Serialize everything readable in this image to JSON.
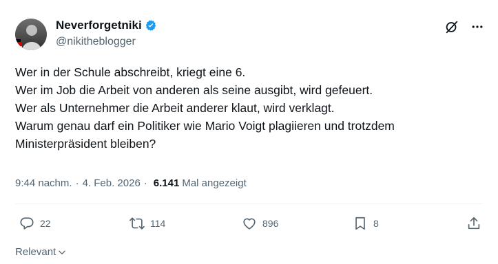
{
  "author": {
    "display_name": "Neverforgetniki",
    "handle": "@nikitheblogger",
    "verified": true,
    "verified_color": "#1d9bf0"
  },
  "top_icons": [
    "grok-icon",
    "more-icon"
  ],
  "tweet": {
    "lines": [
      "Wer in der Schule abschreibt, kriegt eine 6.",
      "Wer im Job die Arbeit von anderen als seine ausgibt, wird gefeuert.",
      "Wer als Unternehmer die Arbeit anderer klaut, wird verklagt.",
      "Warum genau darf ein Politiker wie Mario Voigt plagiieren und trotzdem",
      "Ministerpräsident bleiben?"
    ]
  },
  "meta": {
    "time": "9:44 nachm.",
    "separator": "·",
    "date": "4. Feb. 2026",
    "views_count": "6.141",
    "views_label": "Mal angezeigt"
  },
  "actions": {
    "reply_count": "22",
    "retweet_count": "114",
    "like_count": "896",
    "bookmark_count": "8"
  },
  "sort": {
    "label": "Relevant"
  },
  "colors": {
    "text": "#0f1419",
    "secondary": "#536471",
    "divider": "#eff3f4"
  }
}
